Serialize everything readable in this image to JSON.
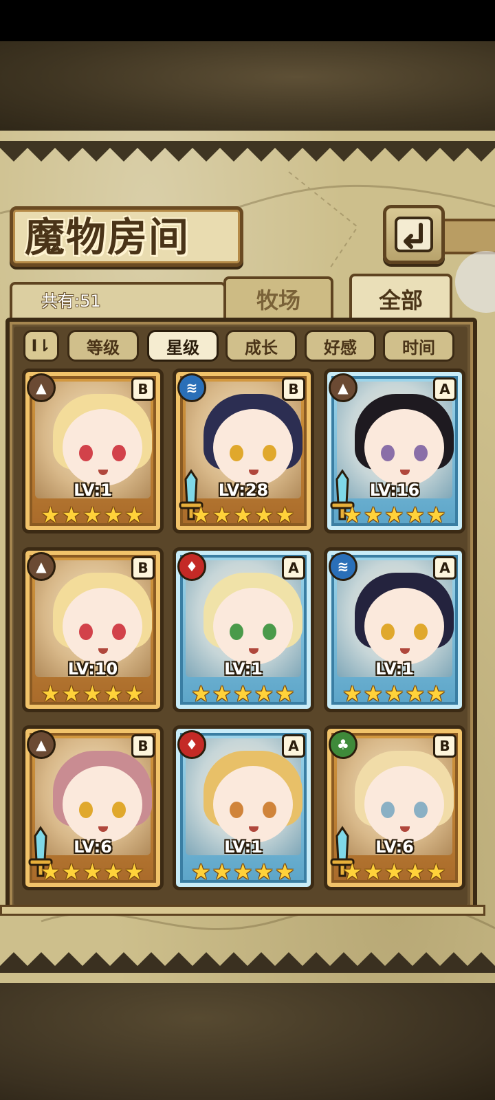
{
  "title": "魔物房间",
  "count_label": "共有:51",
  "tabs": [
    {
      "label": "牧场",
      "active": false
    },
    {
      "label": "全部",
      "active": true
    }
  ],
  "sort_toggle": "I⇂",
  "filters": [
    {
      "label": "等级",
      "active": false
    },
    {
      "label": "星级",
      "active": true
    },
    {
      "label": "成长",
      "active": false
    },
    {
      "label": "好感",
      "active": false
    },
    {
      "label": "时间",
      "active": false
    }
  ],
  "colors": {
    "gold_frame": "#d49a3f",
    "blue_frame": "#9fd7ec",
    "star": "#ffd23a",
    "parchment": "#cdbf8c"
  },
  "monsters": [
    {
      "element": "earth-icon",
      "rank": "B",
      "level": "LV:1",
      "stars": 5,
      "frame": "gold",
      "equipped": false,
      "hair": "#f3dc9a",
      "eye": "#d2424a"
    },
    {
      "element": "water-icon",
      "rank": "B",
      "level": "LV:28",
      "stars": 5,
      "frame": "gold",
      "equipped": true,
      "hair": "#2c2e52",
      "eye": "#e0a82c"
    },
    {
      "element": "earth-icon",
      "rank": "A",
      "level": "LV:16",
      "stars": 5,
      "frame": "blue",
      "equipped": true,
      "hair": "#1e1a20",
      "eye": "#8a6fa8"
    },
    {
      "element": "earth-icon",
      "rank": "B",
      "level": "LV:10",
      "stars": 5,
      "frame": "gold",
      "equipped": false,
      "hair": "#f3dc9a",
      "eye": "#d2424a"
    },
    {
      "element": "fire-icon",
      "rank": "A",
      "level": "LV:1",
      "stars": 5,
      "frame": "blue",
      "equipped": false,
      "hair": "#f0e2a8",
      "eye": "#4a9a4a"
    },
    {
      "element": "water-icon",
      "rank": "A",
      "level": "LV:1",
      "stars": 5,
      "frame": "blue",
      "equipped": false,
      "hair": "#24233e",
      "eye": "#e0a82c"
    },
    {
      "element": "earth-icon",
      "rank": "B",
      "level": "LV:6",
      "stars": 5,
      "frame": "gold",
      "equipped": true,
      "hair": "#c98c92",
      "eye": "#e0a82c"
    },
    {
      "element": "fire-icon",
      "rank": "A",
      "level": "LV:1",
      "stars": 5,
      "frame": "blue",
      "equipped": false,
      "hair": "#e8c068",
      "eye": "#d0843a"
    },
    {
      "element": "wind-icon",
      "rank": "B",
      "level": "LV:6",
      "stars": 5,
      "frame": "gold",
      "equipped": true,
      "hair": "#f1dca8",
      "eye": "#8ab0c4"
    }
  ]
}
